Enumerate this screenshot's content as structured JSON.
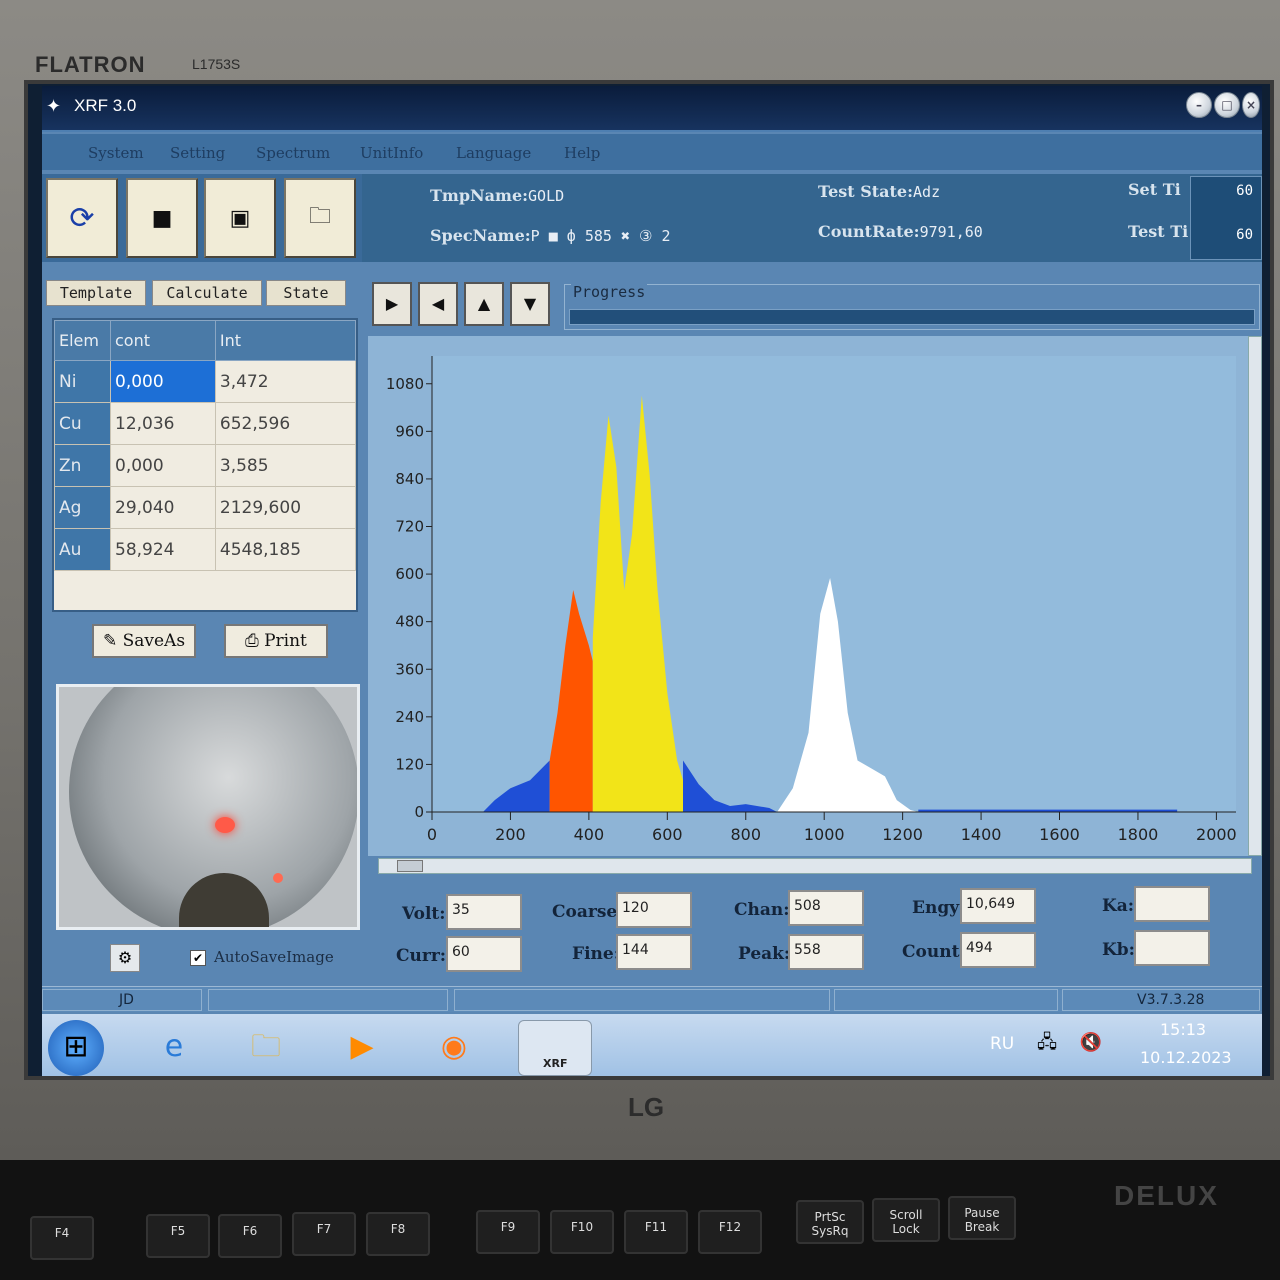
{
  "monitor": {
    "brand": "FLATRON",
    "model": "L1753S",
    "logo": "LG"
  },
  "window": {
    "title": "XRF 3.0",
    "icon": "app-icon",
    "controls": [
      "minimize-icon",
      "maximize-icon",
      "close-icon"
    ]
  },
  "menu": [
    "System",
    "Setting",
    "Spectrum",
    "UnitInfo",
    "Language",
    "Help"
  ],
  "toolbar": {
    "buttons": [
      "refresh-icon",
      "stop-icon",
      "pause-icon",
      "open-folder-icon"
    ],
    "tmp_label": "TmpName:",
    "tmp_value": "GOLD",
    "spec_label": "SpecName:",
    "spec_value": "P ■ ф 585 ✖ ③ 2",
    "test_state_label": "Test State:",
    "test_state_value": "Adz",
    "count_rate_label": "CountRate:",
    "count_rate_value": "9791,60",
    "set_label": "Set Ti",
    "set_value": "60",
    "test_label": "Test Ti",
    "test_value": "60"
  },
  "tabs": [
    "Template",
    "Calculate",
    "State"
  ],
  "table": {
    "headers": [
      "Elem",
      "cont",
      "Int"
    ],
    "rows": [
      [
        "Ni",
        "0,000",
        "3,472"
      ],
      [
        "Cu",
        "12,036",
        "652,596"
      ],
      [
        "Zn",
        "0,000",
        "3,585"
      ],
      [
        "Ag",
        "29,040",
        "2129,600"
      ],
      [
        "Au",
        "58,924",
        "4548,185"
      ]
    ]
  },
  "table_buttons": {
    "save_as": "SaveAs",
    "print": "Print"
  },
  "camera": {
    "autosave_label": "AutoSaveImage",
    "autosave_checked": true
  },
  "nav": [
    "play-icon",
    "back-icon",
    "up-icon",
    "down-icon"
  ],
  "progress": {
    "label": "Progress"
  },
  "chart_data": {
    "type": "area",
    "x_ticks": [
      0,
      200,
      400,
      600,
      800,
      1000,
      1200,
      1400,
      1600,
      1800,
      2000
    ],
    "y_ticks": [
      0,
      120,
      240,
      360,
      480,
      600,
      720,
      840,
      960,
      1080
    ],
    "xlim": [
      0,
      2050
    ],
    "ylim": [
      0,
      1150
    ],
    "grid": false,
    "series": [
      {
        "color": "#1f4fd6",
        "points": [
          [
            130,
            0
          ],
          [
            160,
            30
          ],
          [
            200,
            60
          ],
          [
            250,
            80
          ],
          [
            290,
            120
          ],
          [
            300,
            130
          ],
          [
            300,
            0
          ]
        ]
      },
      {
        "color": "#ff5500",
        "points": [
          [
            300,
            0
          ],
          [
            300,
            130
          ],
          [
            320,
            250
          ],
          [
            340,
            420
          ],
          [
            360,
            560
          ],
          [
            375,
            500
          ],
          [
            400,
            420
          ],
          [
            410,
            380
          ],
          [
            410,
            0
          ]
        ]
      },
      {
        "color": "#f2e418",
        "points": [
          [
            410,
            0
          ],
          [
            410,
            440
          ],
          [
            430,
            780
          ],
          [
            450,
            1000
          ],
          [
            470,
            870
          ],
          [
            490,
            560
          ],
          [
            510,
            700
          ],
          [
            535,
            1050
          ],
          [
            555,
            850
          ],
          [
            575,
            560
          ],
          [
            600,
            300
          ],
          [
            625,
            130
          ],
          [
            640,
            80
          ],
          [
            640,
            0
          ]
        ]
      },
      {
        "color": "#1f4fd6",
        "points": [
          [
            640,
            0
          ],
          [
            640,
            130
          ],
          [
            680,
            70
          ],
          [
            720,
            30
          ],
          [
            760,
            15
          ],
          [
            800,
            20
          ],
          [
            860,
            10
          ],
          [
            880,
            0
          ]
        ]
      },
      {
        "color": "#ffffff",
        "points": [
          [
            880,
            0
          ],
          [
            920,
            60
          ],
          [
            960,
            200
          ],
          [
            990,
            500
          ],
          [
            1015,
            590
          ],
          [
            1035,
            480
          ],
          [
            1060,
            250
          ],
          [
            1085,
            130
          ],
          [
            1120,
            110
          ],
          [
            1155,
            90
          ],
          [
            1185,
            30
          ],
          [
            1220,
            5
          ],
          [
            1240,
            0
          ]
        ]
      },
      {
        "color": "#1f4fd6",
        "points": [
          [
            1240,
            0
          ],
          [
            1240,
            6
          ],
          [
            1900,
            6
          ],
          [
            1900,
            0
          ]
        ]
      }
    ]
  },
  "params": {
    "volt_label": "Volt:",
    "volt": "35",
    "curr_label": "Curr:",
    "curr": "60",
    "coarse_label": "Coarse:",
    "coarse": "120",
    "fine_label": "Fine:",
    "fine": "144",
    "chan_label": "Chan:",
    "chan": "508",
    "peak_label": "Peak:",
    "peak": "558",
    "engy_label": "Engy:",
    "engy": "10,649",
    "count_label": "Count:",
    "count": "494",
    "ka_label": "Ka:",
    "ka": "",
    "kb_label": "Kb:",
    "kb": ""
  },
  "status": {
    "user": "JD",
    "version": "V3.7.3.28"
  },
  "taskbar": {
    "apps": [
      "start-icon",
      "ie-icon",
      "explorer-icon",
      "media-player-icon",
      "firefox-icon",
      "xrf-app-icon"
    ],
    "xrf_label": "XRF",
    "lang": "RU",
    "time": "15:13",
    "date": "10.12.2023"
  },
  "keyboard": {
    "brand": "DELUX",
    "keys": [
      "F4",
      "F5",
      "F6",
      "F7",
      "F8",
      "F9",
      "F10",
      "F11",
      "F12",
      "PrtSc SysRq",
      "Scroll Lock",
      "Pause Break"
    ]
  }
}
